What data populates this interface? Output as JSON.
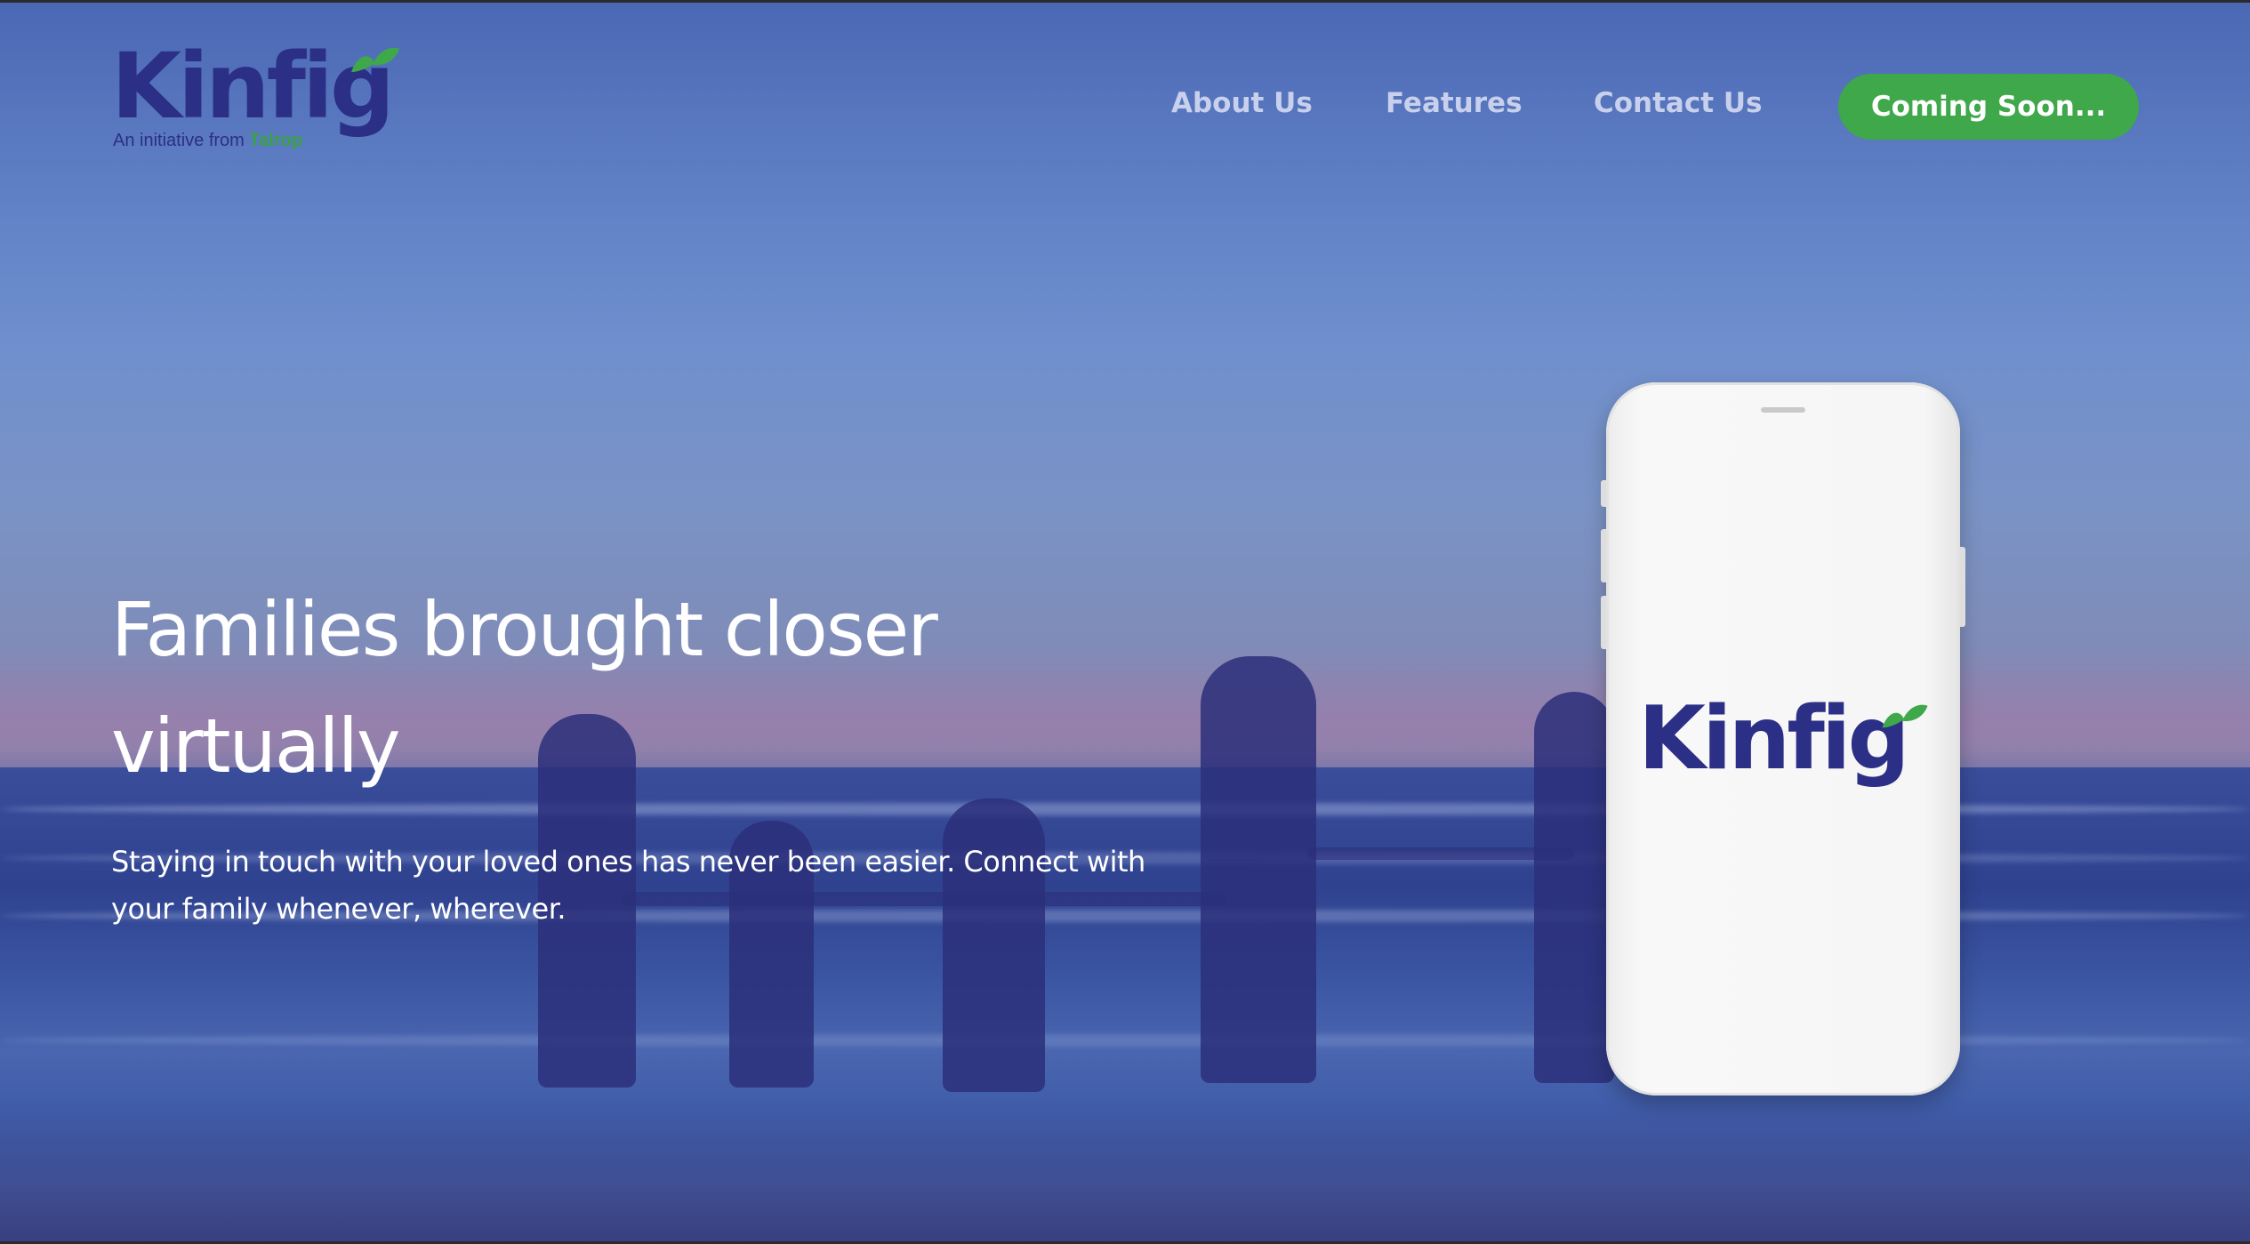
{
  "header": {
    "logo": {
      "wordmark": "Kinfig",
      "tagline_prefix": "An initiative from",
      "tagline_brand": "Talrop"
    },
    "nav": {
      "about": "About Us",
      "features": "Features",
      "contact": "Contact Us"
    },
    "cta_label": "Coming Soon..."
  },
  "hero": {
    "title_line1": "Families brought closer",
    "title_line2": "virtually",
    "subtitle_line1": "Staying in touch with your loved ones has never been easier. Connect with",
    "subtitle_line2": "your family whenever, wherever."
  },
  "phone": {
    "screen_logo": "Kinfig"
  },
  "colors": {
    "brand_navy": "#2c2f86",
    "brand_green": "#3ea84a",
    "overlay_blue": "#4b68b4"
  }
}
